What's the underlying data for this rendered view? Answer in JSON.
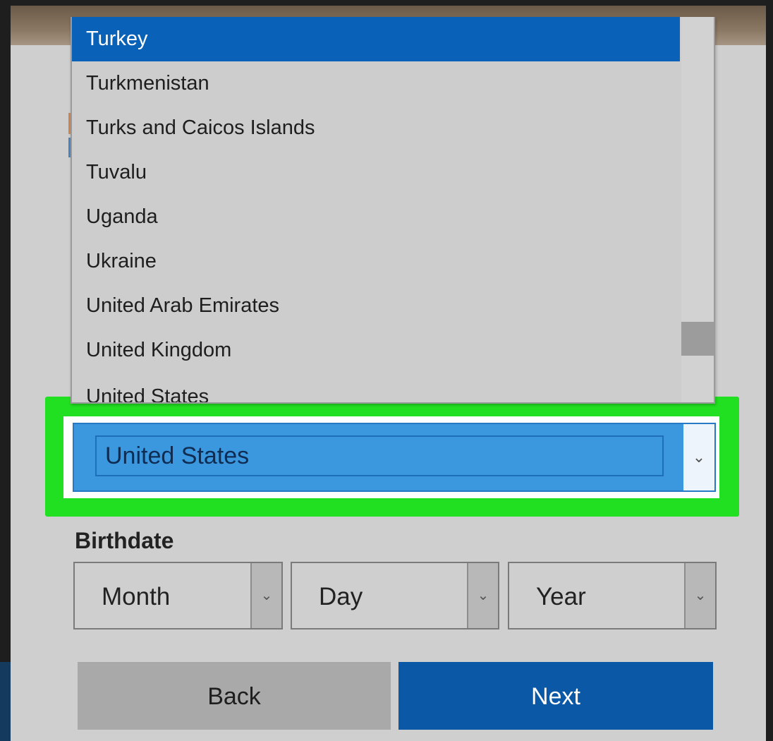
{
  "country_list": {
    "options": [
      "Turkey",
      "Turkmenistan",
      "Turks and Caicos Islands",
      "Tuvalu",
      "Uganda",
      "Ukraine",
      "United Arab Emirates",
      "United Kingdom",
      "United States"
    ],
    "selected_index": 0
  },
  "country_select": {
    "value": "United States"
  },
  "birthdate": {
    "label": "Birthdate",
    "month_placeholder": "Month",
    "day_placeholder": "Day",
    "year_placeholder": "Year"
  },
  "buttons": {
    "back": "Back",
    "next": "Next"
  },
  "icons": {
    "dropdown_arrow": "chevron-down-icon"
  },
  "colors": {
    "highlight": "#21e021",
    "selected_option": "#0a61b8",
    "select_fill": "#3b98df",
    "next_button": "#0a58a6",
    "back_button": "#a9a9a9"
  }
}
